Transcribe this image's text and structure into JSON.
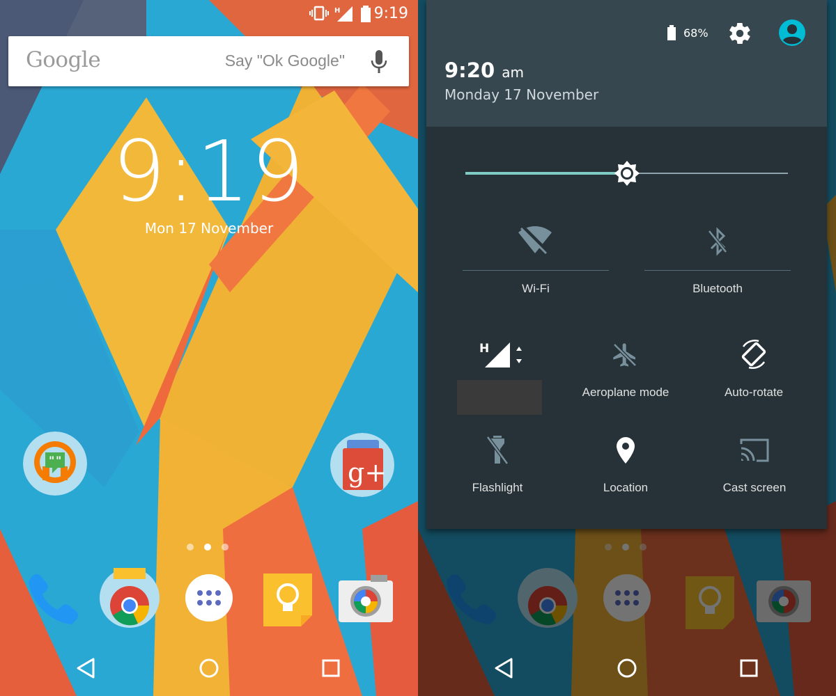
{
  "home": {
    "status": {
      "time": "9:19",
      "icons": [
        "vibrate-icon",
        "h-signal-icon",
        "battery-icon"
      ]
    },
    "search": {
      "logo": "Google",
      "hint": "Say \"Ok Google\""
    },
    "clock": {
      "time": "9:19",
      "date": "Mon 17 November"
    },
    "apps": [
      "hangouts-icon",
      "google-plus-icon"
    ],
    "dock": [
      "phone-icon",
      "chrome-icon",
      "app-drawer-icon",
      "keep-icon",
      "camera-icon"
    ],
    "nav": [
      "back-icon",
      "home-icon",
      "recents-icon"
    ]
  },
  "quick_settings": {
    "battery": "68%",
    "time": "9:20",
    "ampm": "am",
    "date": "Monday 17 November",
    "brightness": 0.5,
    "tiles": {
      "wifi": "Wi-Fi",
      "bluetooth": "Bluetooth",
      "aeroplane": "Aeroplane mode",
      "autorotate": "Auto-rotate",
      "flashlight": "Flashlight",
      "location": "Location",
      "cast": "Cast screen"
    }
  },
  "colors": {
    "accent": "#80cbc4",
    "shade": "#263238",
    "header": "#37474f",
    "account": "#00bcd4"
  }
}
